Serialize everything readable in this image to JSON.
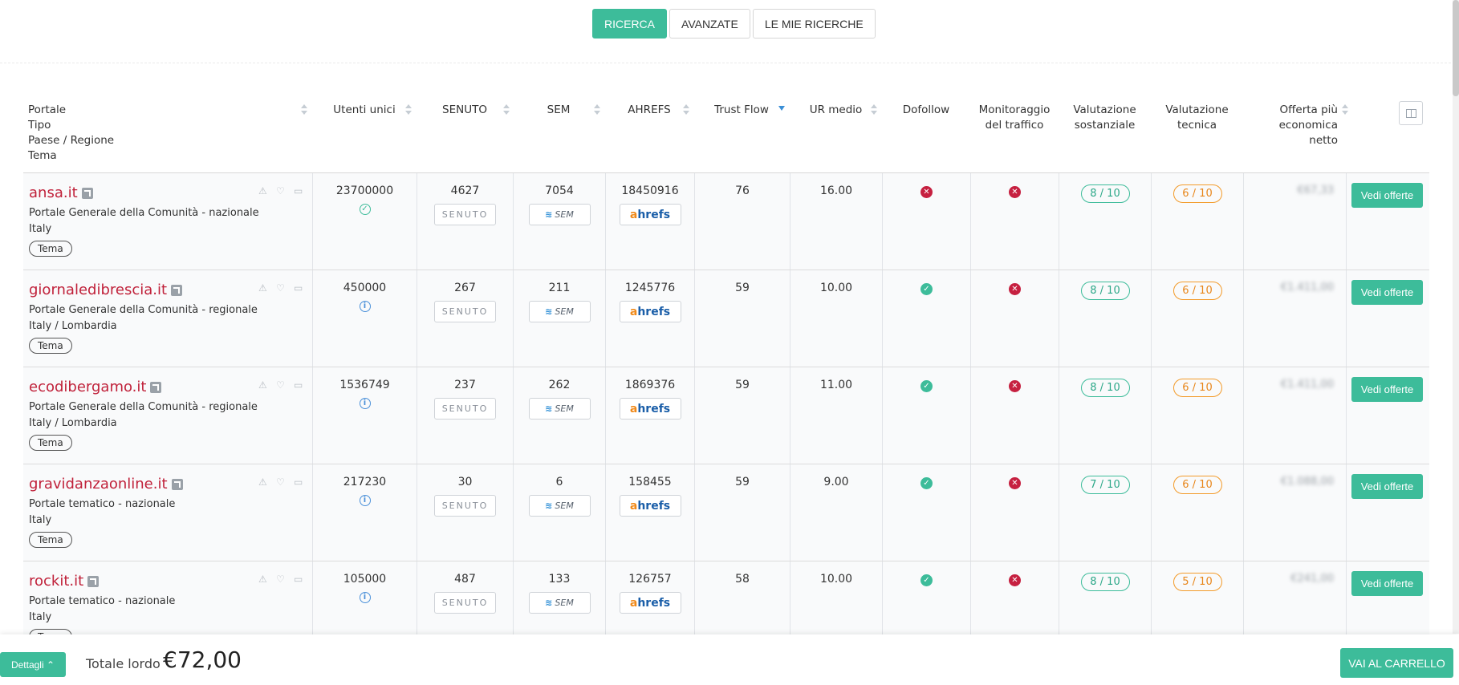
{
  "tabs": [
    "RICERCA",
    "AVANZATE",
    "LE MIE RICERCHE"
  ],
  "headers": {
    "portale": [
      "Portale",
      "Tipo",
      "Paese / Regione",
      "Tema"
    ],
    "utenti": "Utenti unici",
    "senuto": "SENUTO",
    "sem": "SEM",
    "ahrefs": "AHREFS",
    "trust": "Trust Flow",
    "ur": "UR medio",
    "dofollow": "Dofollow",
    "monitor": [
      "Monitoraggio",
      "del traffico"
    ],
    "sost": [
      "Valutazione",
      "sostanziale"
    ],
    "tec": [
      "Valutazione",
      "tecnica"
    ],
    "offerta": [
      "Offerta più",
      "economica",
      "netto"
    ]
  },
  "logos": {
    "senuto": "SENUTO",
    "sem": "SEM",
    "ahrefs_a": "a",
    "ahrefs_rest": "hrefs"
  },
  "rows": [
    {
      "name": "ansa.it",
      "tipo": "Portale Generale della Comunità - nazionale",
      "paese": "Italy",
      "tema": "Tema",
      "utenti": "23700000",
      "badge": "ok",
      "senuto": "4627",
      "sem": "7054",
      "ahrefs": "18450916",
      "trust": "76",
      "ur": "16.00",
      "dofollow": false,
      "monitor": false,
      "sost": "8 / 10",
      "tec": "6 / 10",
      "tec_color": "orange",
      "price": "€67,33",
      "vedi": "Vedi offerte"
    },
    {
      "name": "giornaledibrescia.it",
      "tipo": "Portale Generale della Comunità - regionale",
      "paese": "Italy / Lombardia",
      "tema": "Tema",
      "utenti": "450000",
      "badge": "info",
      "senuto": "267",
      "sem": "211",
      "ahrefs": "1245776",
      "trust": "59",
      "ur": "10.00",
      "dofollow": true,
      "monitor": false,
      "sost": "8 / 10",
      "tec": "6 / 10",
      "tec_color": "orange",
      "price": "€1.411,00",
      "vedi": "Vedi offerte"
    },
    {
      "name": "ecodibergamo.it",
      "tipo": "Portale Generale della Comunità - regionale",
      "paese": "Italy / Lombardia",
      "tema": "Tema",
      "utenti": "1536749",
      "badge": "info",
      "senuto": "237",
      "sem": "262",
      "ahrefs": "1869376",
      "trust": "59",
      "ur": "11.00",
      "dofollow": true,
      "monitor": false,
      "sost": "8 / 10",
      "tec": "6 / 10",
      "tec_color": "orange",
      "price": "€1.411,00",
      "vedi": "Vedi offerte"
    },
    {
      "name": "gravidanzaonline.it",
      "tipo": "Portale tematico - nazionale",
      "paese": "Italy",
      "tema": "Tema",
      "utenti": "217230",
      "badge": "info",
      "senuto": "30",
      "sem": "6",
      "ahrefs": "158455",
      "trust": "59",
      "ur": "9.00",
      "dofollow": true,
      "monitor": false,
      "sost": "7 / 10",
      "tec": "6 / 10",
      "tec_color": "orange",
      "price": "€1.088,00",
      "vedi": "Vedi offerte"
    },
    {
      "name": "rockit.it",
      "tipo": "Portale tematico - nazionale",
      "paese": "Italy",
      "tema": "Tema",
      "utenti": "105000",
      "badge": "info",
      "senuto": "487",
      "sem": "133",
      "ahrefs": "126757",
      "trust": "58",
      "ur": "10.00",
      "dofollow": true,
      "monitor": false,
      "sost": "8 / 10",
      "tec": "5 / 10",
      "tec_color": "orange",
      "price": "€241,00",
      "vedi": "Vedi offerte"
    }
  ],
  "footer": {
    "details": "Dettagli",
    "total_label": "Totale lordo",
    "total_value": "€72,00",
    "cart": "VAI AL CARRELLO"
  },
  "colors": {
    "accent": "#3dbc9a",
    "brand_red": "#c0213a",
    "orange": "#f39b2a"
  }
}
